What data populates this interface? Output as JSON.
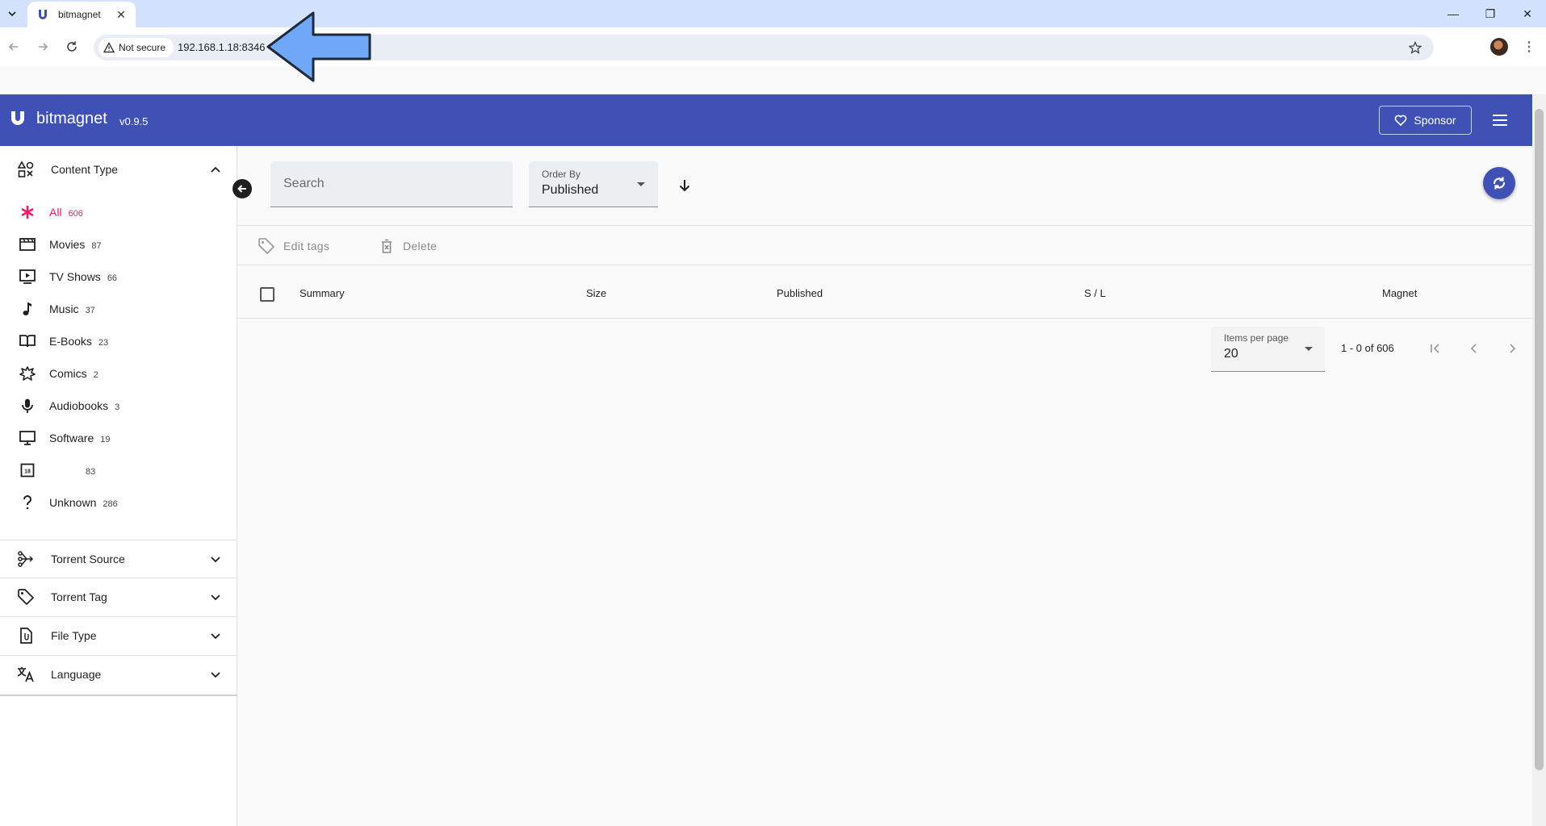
{
  "browser": {
    "tab_title": "bitmagnet",
    "security_label": "Not secure",
    "url": "192.168.1.18:8346"
  },
  "app": {
    "name": "bitmagnet",
    "version": "v0.9.5",
    "brand_color": "#3f51b5",
    "sponsor_label": "Sponsor"
  },
  "sidebar": {
    "content_type": {
      "title": "Content Type",
      "items": [
        {
          "label": "All",
          "count": "606",
          "icon": "asterisk-icon",
          "active": true
        },
        {
          "label": "Movies",
          "count": "87",
          "icon": "movie-icon"
        },
        {
          "label": "TV Shows",
          "count": "66",
          "icon": "tv-icon"
        },
        {
          "label": "Music",
          "count": "37",
          "icon": "music-note-icon"
        },
        {
          "label": "E-Books",
          "count": "23",
          "icon": "book-icon"
        },
        {
          "label": "Comics",
          "count": "2",
          "icon": "comic-burst-icon"
        },
        {
          "label": "Audiobooks",
          "count": "3",
          "icon": "microphone-icon"
        },
        {
          "label": "Software",
          "count": "19",
          "icon": "monitor-icon"
        },
        {
          "label": "",
          "count": "83",
          "icon": "rating-18-icon"
        },
        {
          "label": "Unknown",
          "count": "286",
          "icon": "question-mark-icon"
        }
      ]
    },
    "sections": [
      {
        "title": "Torrent Source",
        "icon": "source-branch-icon"
      },
      {
        "title": "Torrent Tag",
        "icon": "tag-icon"
      },
      {
        "title": "File Type",
        "icon": "file-icon"
      },
      {
        "title": "Language",
        "icon": "translate-icon"
      }
    ]
  },
  "filters": {
    "search_placeholder": "Search",
    "order_by_label": "Order By",
    "order_by_value": "Published"
  },
  "actions": {
    "edit_tags": "Edit tags",
    "delete": "Delete"
  },
  "table": {
    "columns": [
      "Summary",
      "Size",
      "Published",
      "S / L",
      "Magnet"
    ]
  },
  "paginator": {
    "items_per_page_label": "Items per page",
    "items_per_page_value": "20",
    "range": "1 - 0 of 606"
  },
  "annotation": {
    "arrow_color": "#6ea8f7"
  }
}
